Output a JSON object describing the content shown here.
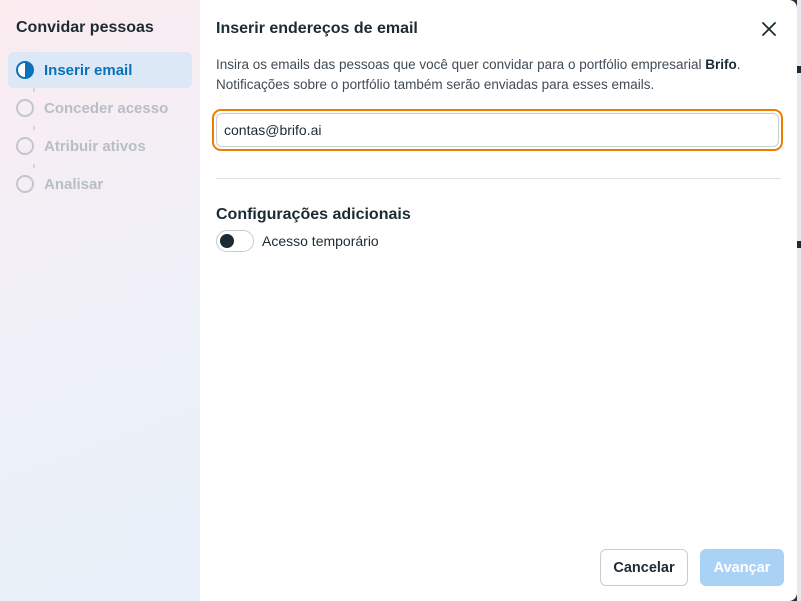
{
  "sidebar": {
    "title": "Convidar pessoas",
    "steps": [
      {
        "label": "Inserir email",
        "active": true
      },
      {
        "label": "Conceder acesso",
        "active": false
      },
      {
        "label": "Atribuir ativos",
        "active": false
      },
      {
        "label": "Analisar",
        "active": false
      }
    ]
  },
  "header": {
    "title": "Inserir endereços de email",
    "close_icon": "close-icon"
  },
  "description": {
    "part1": "Insira os emails das pessoas que você quer convidar para o portfólio empresarial ",
    "business_name": "Brifo",
    "part2": ". Notificações sobre o portfólio também serão enviadas para esses emails."
  },
  "email_input": {
    "value": "contas@brifo.ai",
    "focus_color": "#f07d00"
  },
  "additional_settings": {
    "title": "Configurações adicionais",
    "toggle_label": "Acesso temporário",
    "toggle_on": false
  },
  "footer": {
    "cancel_label": "Cancelar",
    "next_label": "Avançar",
    "next_disabled": true
  },
  "colors": {
    "accent": "#0a72b8",
    "disabled_button": "#a9d2f5"
  }
}
